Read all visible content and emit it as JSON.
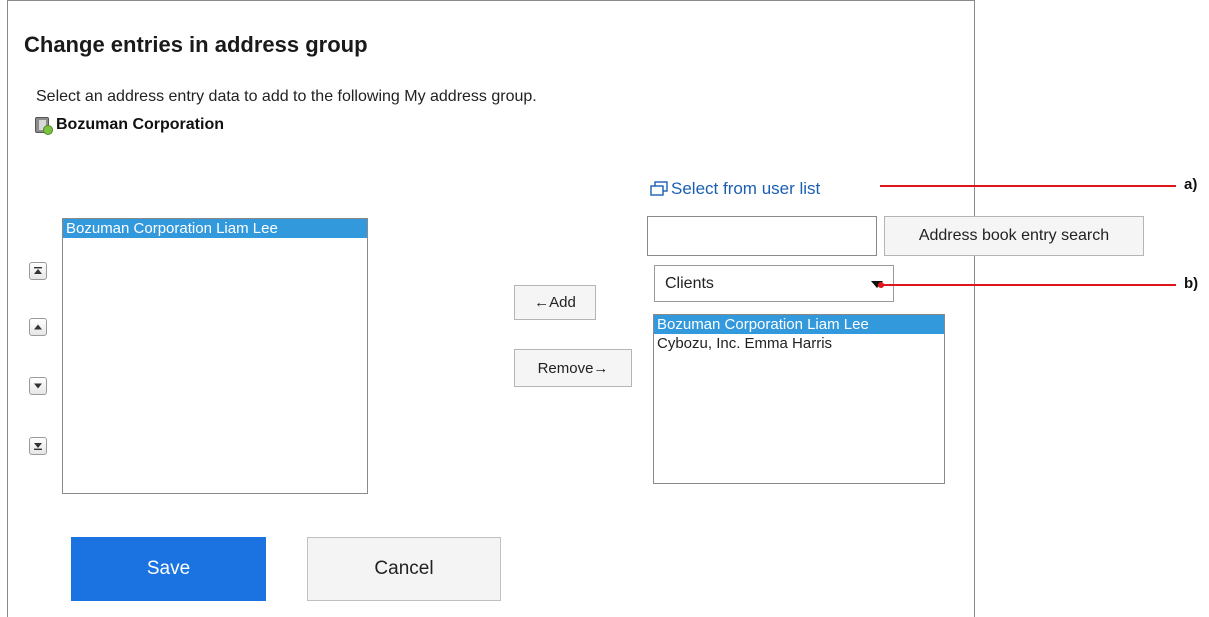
{
  "page": {
    "title": "Change entries in address group",
    "description": "Select an address entry data to add to the following My address group.",
    "group_name": "Bozuman Corporation"
  },
  "left_list": {
    "items": [
      {
        "label": "Bozuman Corporation Liam Lee",
        "selected": true
      }
    ]
  },
  "order_buttons": {
    "icons": [
      "move-to-top-icon",
      "move-up-icon",
      "move-down-icon",
      "move-to-bottom-icon"
    ]
  },
  "transfer": {
    "add_label": "←Add",
    "remove_label": "Remove→"
  },
  "right_panel": {
    "select_from_user_list": "Select from user list",
    "search_value": "",
    "search_button": "Address book entry search",
    "category_selected": "Clients",
    "items": [
      {
        "label": "Bozuman Corporation Liam Lee",
        "selected": true
      },
      {
        "label": "Cybozu, Inc. Emma Harris",
        "selected": false
      }
    ]
  },
  "callouts": {
    "a": "a)",
    "b": "b)"
  },
  "actions": {
    "save_label": "Save",
    "cancel_label": "Cancel"
  },
  "colors": {
    "link": "#1a5fb4",
    "selection": "#3399dd",
    "primary_button": "#1a73e0",
    "callout": "#e0151b"
  }
}
